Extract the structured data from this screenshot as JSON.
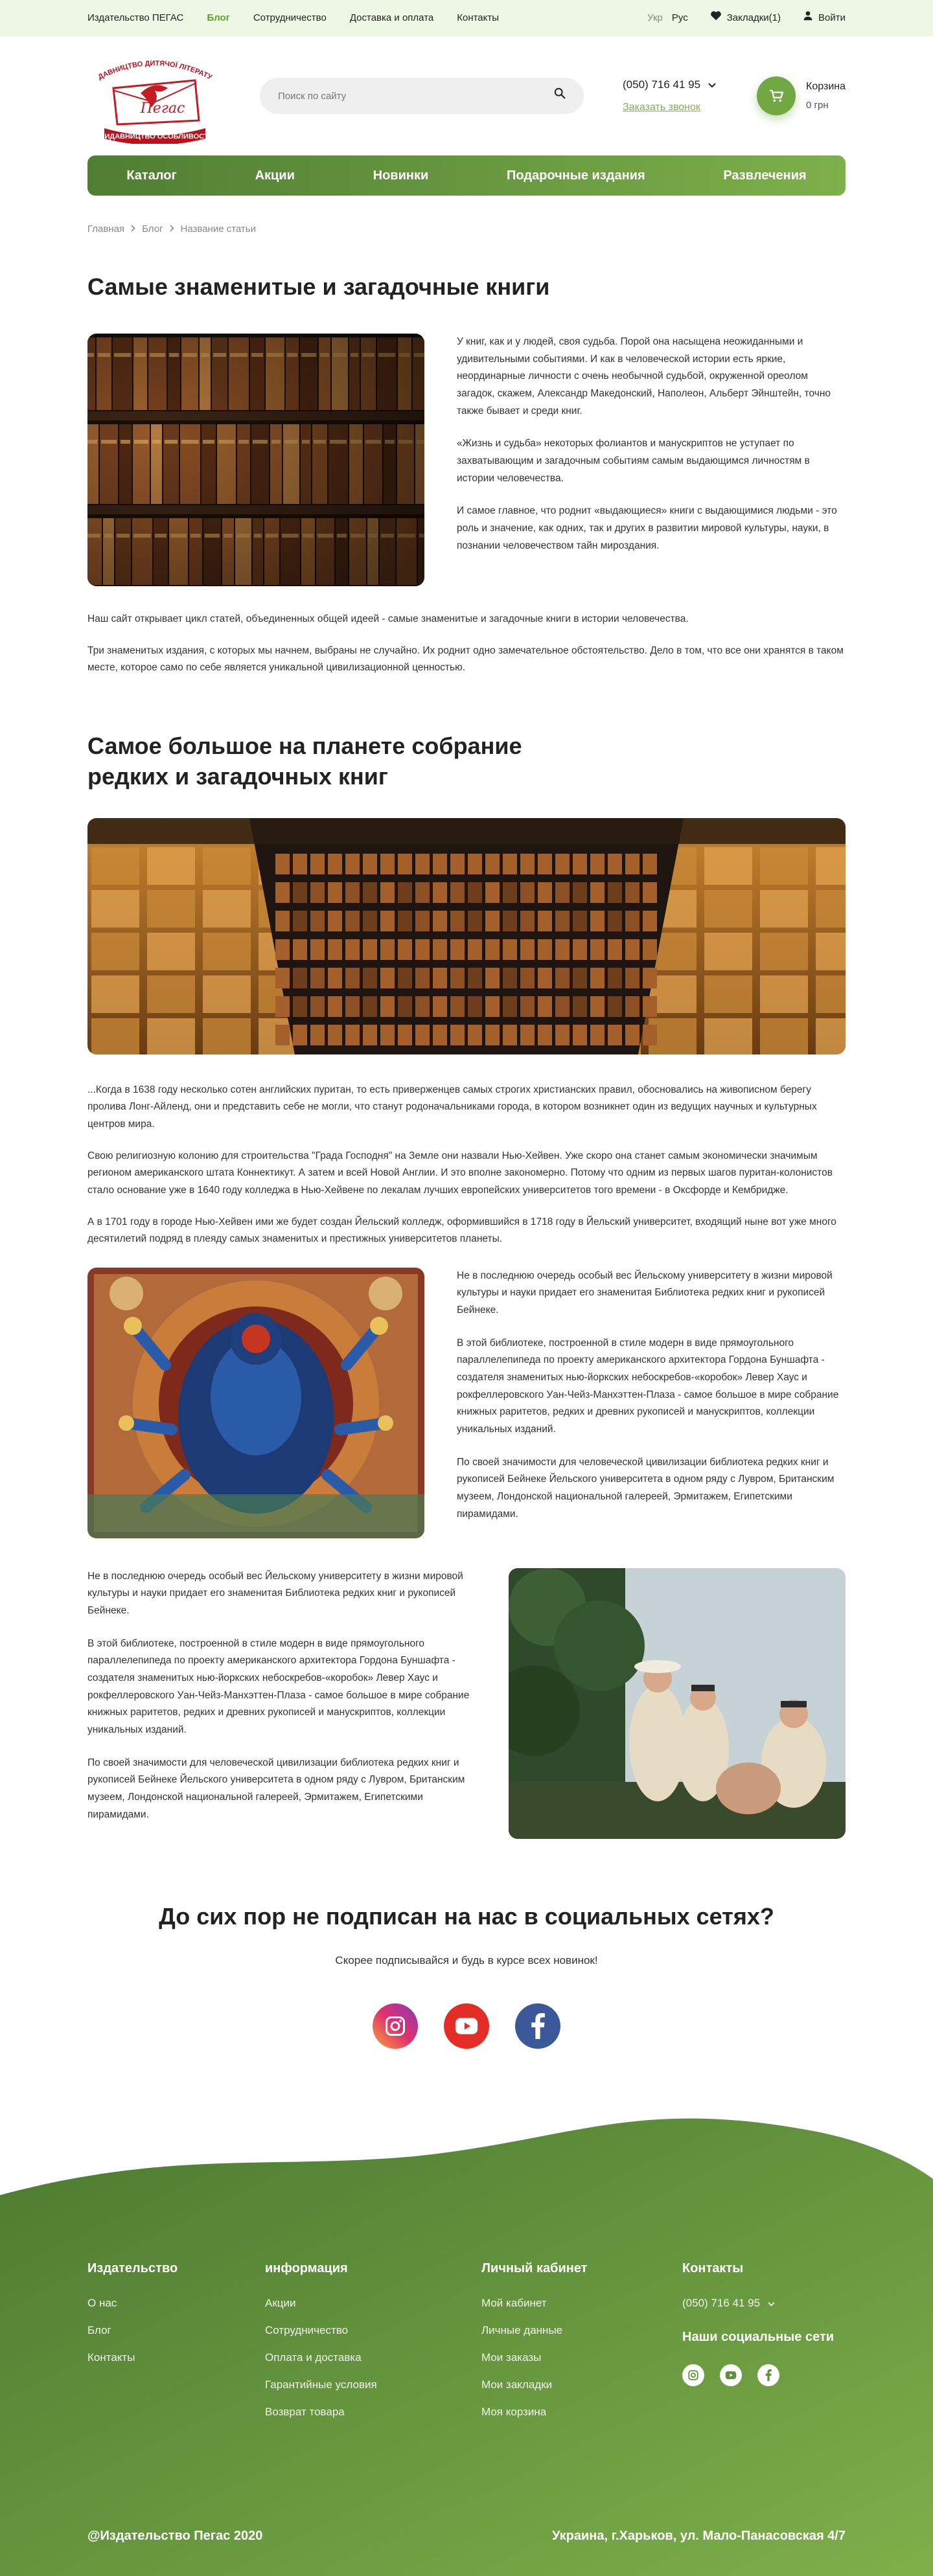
{
  "topbar": {
    "links": [
      "Издательство ПЕГАС",
      "Блог",
      "Сотрудничество",
      "Доставка и оплата",
      "Контакты"
    ],
    "active_link": "Блог",
    "lang_off": "Укр",
    "lang_on": "Рус",
    "bookmarks": "Закладки(1)",
    "login": "Войти"
  },
  "logo": {
    "top_text": "ВИДАВНИЦТВО ДИТЯЧОЇ ЛІТЕРАТУРИ",
    "brand": "Пегас",
    "bottom_text": "ВИДАВНИЦТВО ОСОБЛИВОСТІ"
  },
  "search": {
    "placeholder": "Поиск по сайту"
  },
  "contact": {
    "phone": "(050) 716 41 95",
    "callback": "Заказать звонок"
  },
  "cart": {
    "label": "Корзина",
    "sum": "0 грн"
  },
  "mainnav": [
    "Каталог",
    "Акции",
    "Новинки",
    "Подарочные издания",
    "Развлечения"
  ],
  "breadcrumb": [
    "Главная",
    "Блог",
    "Название статьи"
  ],
  "article": {
    "title": "Самые знаменитые и загадочные книги",
    "intro": [
      "У книг, как и у людей, своя судьба. Порой она насыщена неожиданными и удивительными событиями. И как в человеческой истории есть яркие, неординарные личности с очень необычной судьбой, окруженной ореолом загадок, скажем, Александр Македонский, Наполеон, Альберт Эйнштейн, точно также бывает и среди книг.",
      "«Жизнь и судьба» некоторых фолиантов и манускриптов не уступает по захватывающим и загадочным событиям самым выдающимся личностям в истории человечества.",
      "И самое главное, что роднит «выдающиеся» книги с выдающимися людьми - это роль и значение, как одних, так и других в развитии мировой культуры, науки, в познании человечеством тайн мироздания."
    ],
    "p1": "Наш сайт открывает цикл статей, объединенных общей идеей - самые знаменитые и загадочные книги в истории человечества.",
    "p2": "Три знаменитых издания, с которых мы начнем, выбраны не случайно. Их роднит одно замечательное обстоятельство. Дело в том, что все они хранятся в таком месте, которое само по себе является уникальной цивилизационной ценностью.",
    "h2": "Самое большое на планете собрание редких и загадочных книг",
    "p3": "...Когда в 1638 году несколько сотен английских пуритан, то есть приверженцев самых строгих христианских правил, обосновались на живописном берегу пролива Лонг-Айленд, они и представить себе не могли, что станут родоначальниками города, в котором возникнет один из ведущих научных и культурных центров мира.",
    "p4": "Свою религиозную колонию для строительства \"Града Господня\" на Земле они назвали Нью-Хейвен. Уже скоро она станет самым экономически значимым регионом американского штата Коннектикут. А затем и всей Новой Англии. И это вполне закономерно. Потому что одним из первых шагов пуритан-колонистов стало основание уже в 1640 году колледжа в Нью-Хейвене по лекалам лучших европейских университетов того времени - в Оксфорде и Кембридже.",
    "p5": "А в 1701 году в городе Нью-Хейвен ими же будет создан Йельский колледж, оформившийся в 1718 году в Йельский университет, входящий ныне вот уже много десятилетий подряд в плеяду самых знаменитых и престижных университетов планеты.",
    "block": [
      "Не в последнюю очередь особый вес Йельскому университету в жизни мировой культуры и науки придает его знаменитая Библиотека редких книг и рукописей Бейнеке.",
      "В этой библиотеке, построенной в стиле модерн в виде прямоугольного параллелепипеда по проекту американского архитектора Гордона Буншафта - создателя знаменитых нью-йоркских небоскребов-«коробок» Левер Хаус и рокфеллеровского Уан-Чейз-Манхэттен-Плаза - самое большое в мире собрание книжных раритетов, редких и древних рукописей и манускриптов, коллекции уникальных изданий.",
      "По своей значимости для человеческой цивилизации библиотека редких книг и рукописей Бейнеке Йельского университета в одном ряду с Лувром, Британским музеем, Лондонской национальной галереей, Эрмитажем, Египетскими пирамидами."
    ]
  },
  "subscribe": {
    "title": "До сих пор не подписан на нас в социальных сетях?",
    "text": "Скорее подписывайся и будь в курсе всех новинок!"
  },
  "footer": {
    "col1": {
      "title": "Издательство",
      "links": [
        "О нас",
        "Блог",
        "Контакты"
      ]
    },
    "col2": {
      "title": "информация",
      "links": [
        "Акции",
        "Сотрудничество",
        "Оплата и доставка",
        "Гарантийные условия",
        "Возврат товара"
      ]
    },
    "col3": {
      "title": "Личный кабинет",
      "links": [
        "Мой кабинет",
        "Личные данные",
        "Мои заказы",
        "Мои закладки",
        "Моя корзина"
      ]
    },
    "col4": {
      "title": "Контакты",
      "phone": "(050) 716 41 95",
      "social_title": "Наши социальные сети"
    },
    "copyright": "@Издательство Пегас 2020",
    "address": "Украина,  г.Харьков, ул. Мало-Панасовская 4/7"
  },
  "colors": {
    "accent": "#7cb342",
    "nav_dark": "#4f7e33",
    "nav_light": "#7db04a",
    "instagram": "#e1306c",
    "youtube": "#e52d27",
    "facebook": "#3b5998"
  },
  "icons": [
    "heart-icon",
    "user-icon",
    "search-icon",
    "chevron-down-icon",
    "cart-icon",
    "chevron-right-icon",
    "instagram-icon",
    "youtube-icon",
    "facebook-icon"
  ]
}
